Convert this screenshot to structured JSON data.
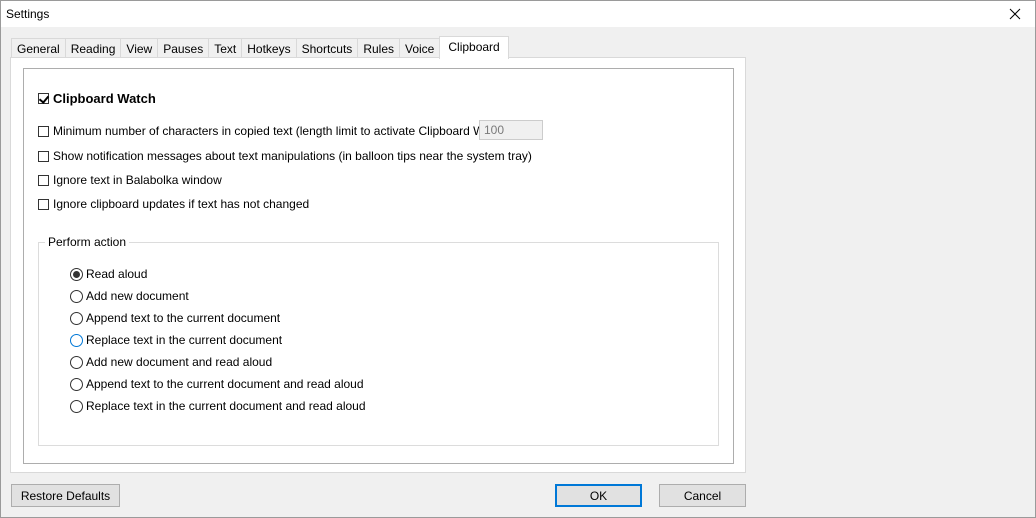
{
  "window": {
    "title": "Settings"
  },
  "tabs": [
    "General",
    "Reading",
    "View",
    "Pauses",
    "Text",
    "Hotkeys",
    "Shortcuts",
    "Rules",
    "Voice",
    "Clipboard"
  ],
  "active_tab": "Clipboard",
  "clipboard": {
    "watch_label": "Clipboard Watch",
    "watch_checked": true,
    "options": [
      {
        "label": "Minimum number of characters in copied text (length limit to activate Clipboard Watch):",
        "checked": false
      },
      {
        "label": "Show notification messages about text manipulations (in balloon tips near the system tray)",
        "checked": false
      },
      {
        "label": "Ignore text in Balabolka window",
        "checked": false
      },
      {
        "label": "Ignore clipboard updates if text has not changed",
        "checked": false
      }
    ],
    "min_chars_value": "100"
  },
  "perform_action": {
    "legend": "Perform action",
    "selected": "Read aloud",
    "options": [
      "Read aloud",
      "Add new document",
      "Append text to the current document",
      "Replace text in the current document",
      "Add new document and read aloud",
      "Append text to the current document and read aloud",
      "Replace text in the current document and read aloud"
    ]
  },
  "buttons": {
    "restore": "Restore Defaults",
    "ok": "OK",
    "cancel": "Cancel"
  },
  "colors": {
    "accent": "#0078d7",
    "window_bg": "#f0f0f0",
    "panel_bg": "#ffffff"
  }
}
